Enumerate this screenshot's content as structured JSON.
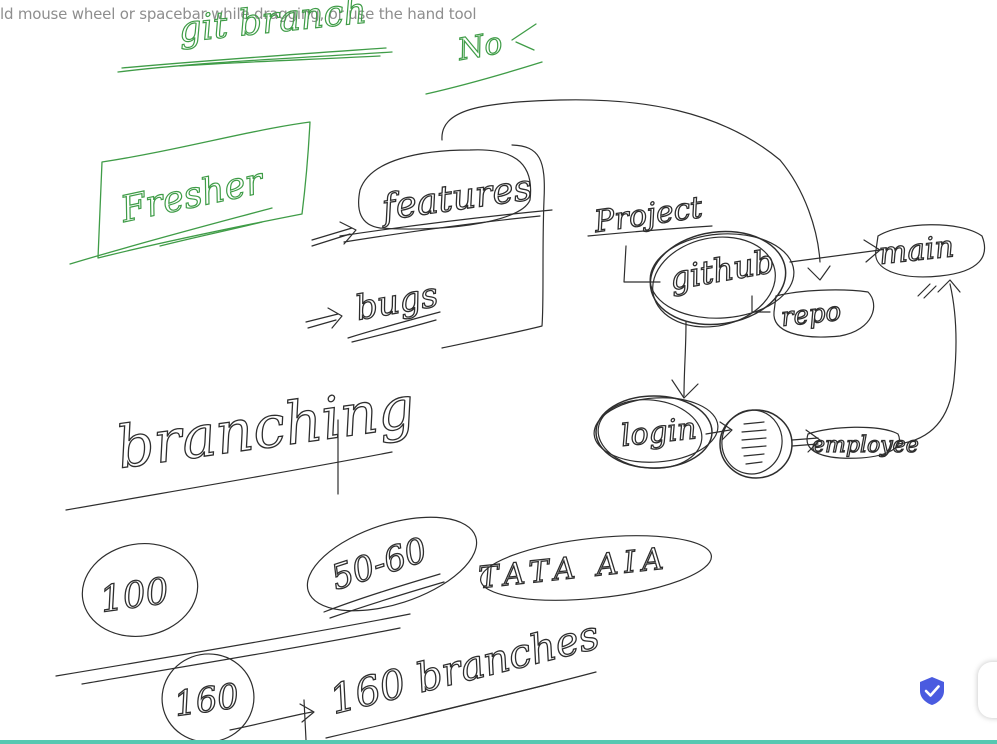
{
  "hint": {
    "text": "ld mouse wheel or spacebar while dragging, or use the hand tool"
  },
  "notes": {
    "git_branch": "git branch",
    "no": "No",
    "fresher": "Fresher",
    "features": "features",
    "bugs": "bugs",
    "project": "Project",
    "github": "github",
    "main": "main",
    "repo": "repo",
    "login": "login",
    "employee": "employee",
    "branching": "branching",
    "n100": "100",
    "n50_60": "50-60",
    "tata": "TATA AIA",
    "n160": "160",
    "branches_160": "160 branches"
  },
  "colors": {
    "ink": "#2e2e2e",
    "green": "#3f9c47",
    "badge": "#4a5be0",
    "bar": "#56c8b1"
  },
  "icons": {
    "badge": "shield-check-icon"
  }
}
